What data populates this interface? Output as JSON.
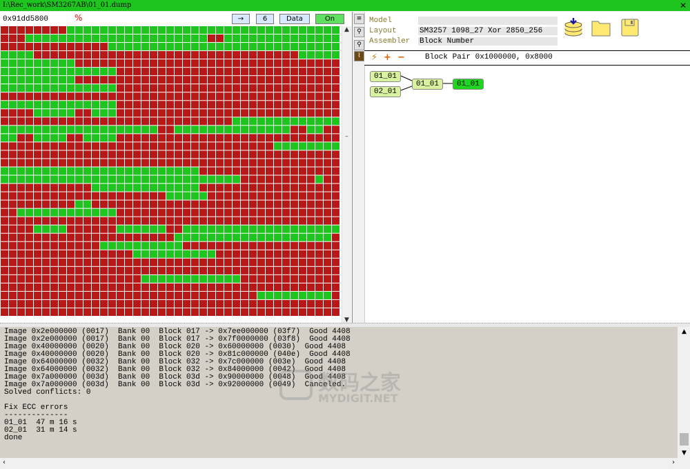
{
  "window": {
    "title": "I:\\Rec_work\\SM3267AB\\01_01.dump",
    "close_label": "✕"
  },
  "map_toolbar": {
    "address": "0x91dd5800",
    "percent_icon": "%",
    "arrow_label": "→",
    "count_label": "6",
    "data_label": "Data",
    "on_label": "On"
  },
  "block_map": {
    "cols": 41,
    "row_count": 35,
    "colors": {
      "good": "#1fc51f",
      "bad": "#b81818"
    },
    "rows": [
      [
        [
          0,
          8
        ]
      ],
      [
        [
          0,
          3
        ],
        [
          25,
          2
        ]
      ],
      [
        [
          0,
          13
        ]
      ],
      [
        [
          4,
          32
        ]
      ],
      [
        [
          9,
          32
        ]
      ],
      [
        [
          14,
          27
        ]
      ],
      [
        [
          9,
          32
        ]
      ],
      [
        [
          14,
          27
        ]
      ],
      [
        [
          0,
          41
        ]
      ],
      [
        [
          14,
          27
        ]
      ],
      [
        [
          0,
          4
        ],
        [
          9,
          2
        ],
        [
          14,
          27
        ]
      ],
      [
        [
          0,
          28
        ]
      ],
      [
        [
          19,
          2
        ],
        [
          35,
          2
        ],
        [
          39,
          2
        ]
      ],
      [
        [
          2,
          2
        ],
        [
          8,
          2
        ],
        [
          14,
          27
        ]
      ],
      [
        [
          0,
          33
        ]
      ],
      [
        [
          0,
          41
        ]
      ],
      [
        [
          0,
          41
        ]
      ],
      [
        [
          24,
          17
        ]
      ],
      [
        [
          29,
          9
        ],
        [
          39,
          2
        ]
      ],
      [
        [
          0,
          11
        ],
        [
          24,
          17
        ]
      ],
      [
        [
          0,
          20
        ],
        [
          25,
          16
        ]
      ],
      [
        [
          0,
          9
        ],
        [
          11,
          30
        ]
      ],
      [
        [
          0,
          2
        ],
        [
          14,
          27
        ]
      ],
      [
        [
          0,
          41
        ]
      ],
      [
        [
          0,
          4
        ],
        [
          8,
          6
        ],
        [
          20,
          2
        ]
      ],
      [
        [
          0,
          21
        ],
        [
          40,
          1
        ]
      ],
      [
        [
          0,
          12
        ],
        [
          22,
          19
        ]
      ],
      [
        [
          0,
          16
        ],
        [
          26,
          15
        ]
      ],
      [
        [
          0,
          41
        ]
      ],
      [
        [
          0,
          41
        ]
      ],
      [
        [
          0,
          17
        ],
        [
          29,
          12
        ]
      ],
      [
        [
          0,
          41
        ]
      ],
      [
        [
          0,
          31
        ],
        [
          40,
          1
        ]
      ],
      [
        [
          0,
          41
        ]
      ],
      [
        [
          0,
          41
        ]
      ]
    ]
  },
  "sidebar": {
    "icons": [
      "list-icon",
      "pin-icon",
      "pin-icon",
      "chart-icon"
    ]
  },
  "properties": {
    "model_label": "Model",
    "model_value": "",
    "layout_label": "Layout",
    "layout_value": "SM3257 1098_27 Xor 2850_256",
    "assembler_label": "Assembler",
    "assembler_value": "Block Number"
  },
  "block_bar": {
    "text": "Block Pair 0x1000000, 0x8000"
  },
  "tree": {
    "node_a": "01_01",
    "node_b": "02_01",
    "node_mid": "01_01",
    "node_out": "01_01"
  },
  "log": {
    "lines": [
      "Image 0x2e000000 (0017)  Bank 00  Block 017 -> 0x7ee000000 (03f7)  Good 4408",
      "Image 0x2e000000 (0017)  Bank 00  Block 017 -> 0x7f0000000 (03f8)  Good 4408",
      "Image 0x40000000 (0020)  Bank 00  Block 020 -> 0x60000000 (0030)  Good 4408",
      "Image 0x40000000 (0020)  Bank 00  Block 020 -> 0x81c000000 (040e)  Good 4408",
      "Image 0x64000000 (0032)  Bank 00  Block 032 -> 0x7c000000 (003e)  Good 4408",
      "Image 0x64000000 (0032)  Bank 00  Block 032 -> 0x84000000 (0042)  Good 4408",
      "Image 0x7a000000 (003d)  Bank 00  Block 03d -> 0x90000000 (0048)  Good 4408",
      "Image 0x7a000000 (003d)  Bank 00  Block 03d -> 0x92000000 (0049)  Canceled.",
      "Solved conflicts: 0",
      "",
      "Fix ECC errors",
      "--------------",
      "01_01  47 m 16 s",
      "02_01  31 m 14 s",
      "done"
    ]
  },
  "watermark": {
    "cn": "数码之家",
    "en": "MYDIGIT.NET"
  }
}
